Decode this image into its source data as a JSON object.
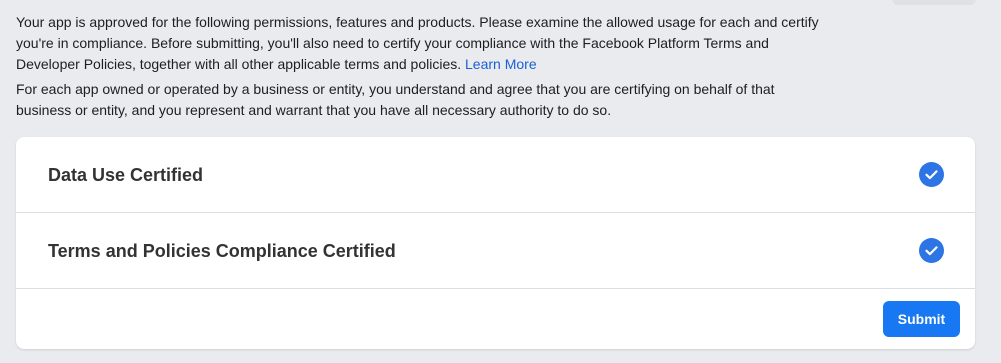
{
  "intro": {
    "paragraph1": "Your app is approved for the following permissions, features and products. Please examine the allowed usage for each and certify you're in compliance. Before submitting, you'll also need to certify your compliance with the Facebook Platform Terms and Developer Policies, together with all other applicable terms and policies.",
    "learn_more_label": "Learn More",
    "paragraph2": "For each app owned or operated by a business or entity, you understand and agree that you are certifying on behalf of that business or entity, and you represent and warrant that you have all necessary authority to do so."
  },
  "certifications": [
    {
      "label": "Data Use Certified",
      "status_icon": "check-circle-icon",
      "checked": true
    },
    {
      "label": "Terms and Policies Compliance Certified",
      "status_icon": "check-circle-icon",
      "checked": true
    }
  ],
  "footer": {
    "submit_label": "Submit"
  },
  "colors": {
    "page_background": "#e9ebee",
    "card_background": "#ffffff",
    "link": "#1b5fd6",
    "check": "#2d74e4",
    "primary_button": "#1877f2"
  }
}
